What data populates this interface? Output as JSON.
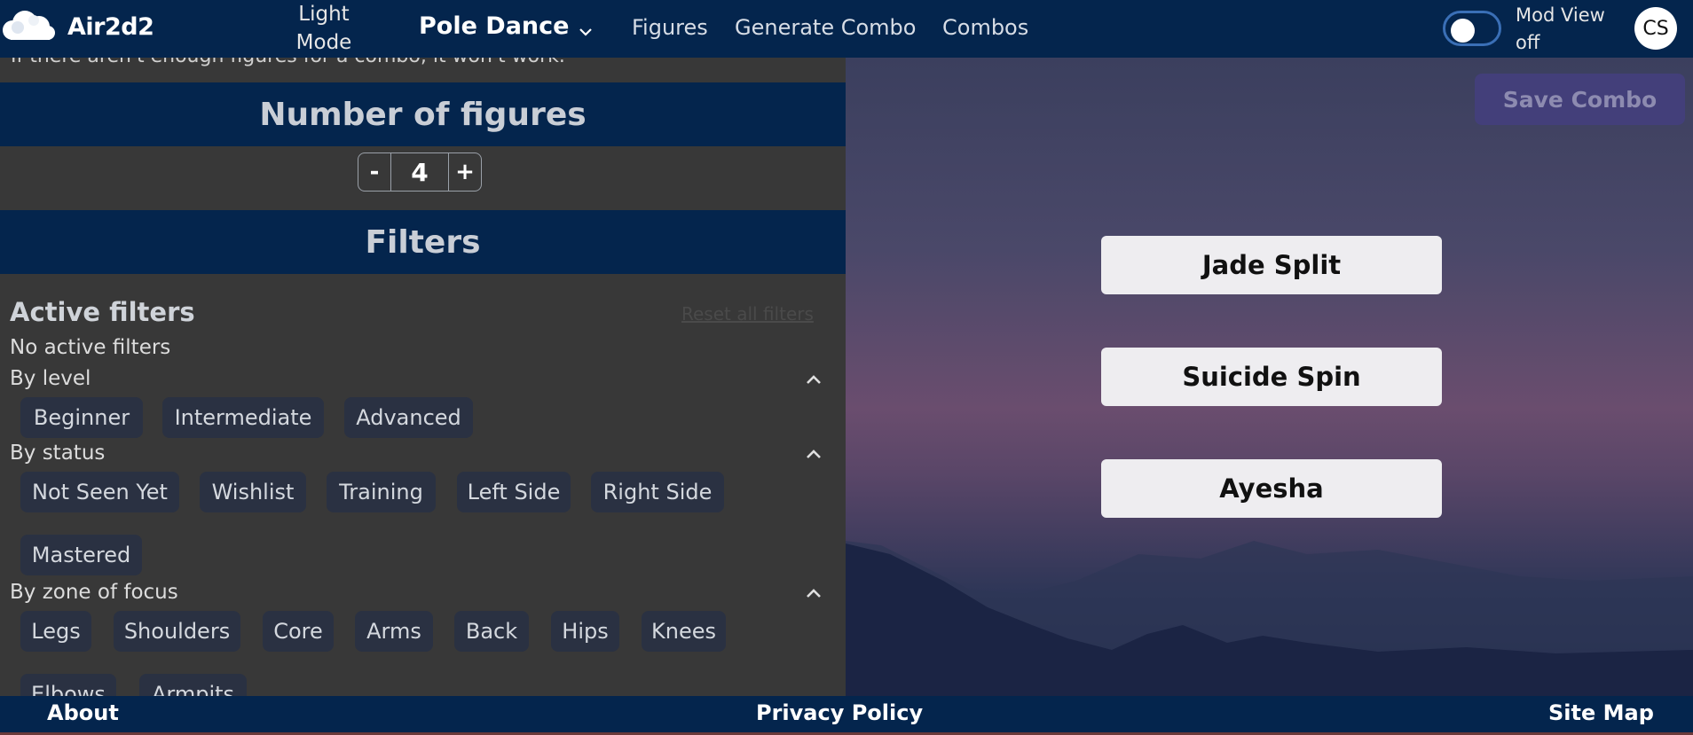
{
  "nav": {
    "brand": "Air2d2",
    "light_mode_line1": "Light",
    "light_mode_line2": "Mode",
    "sport": "Pole Dance",
    "links": [
      "Figures",
      "Generate Combo",
      "Combos"
    ],
    "mod_view_line1": "Mod View",
    "mod_view_line2": "off",
    "avatar_initials": "CS"
  },
  "left": {
    "cut_note": "If there aren't enough figures for a combo, it won't work.",
    "number_heading": "Number of figures",
    "stepper": {
      "minus": "-",
      "value": "4",
      "plus": "+"
    },
    "filters_heading": "Filters",
    "active_filters_title": "Active filters",
    "reset_label": "Reset all filters",
    "no_active": "No active filters",
    "groups": {
      "level": {
        "label": "By level",
        "chips": [
          "Beginner",
          "Intermediate",
          "Advanced"
        ]
      },
      "status": {
        "label": "By status",
        "chips": [
          "Not Seen Yet",
          "Wishlist",
          "Training",
          "Left Side",
          "Right Side",
          "Mastered"
        ]
      },
      "zone": {
        "label": "By zone of focus",
        "chips": [
          "Legs",
          "Shoulders",
          "Core",
          "Arms",
          "Back",
          "Hips",
          "Knees",
          "Elbows",
          "Armpits"
        ]
      }
    }
  },
  "right": {
    "save_label": "Save Combo",
    "figures": [
      "Jade Split",
      "Suicide Spin",
      "Ayesha"
    ]
  },
  "footer": {
    "about": "About",
    "privacy": "Privacy Policy",
    "sitemap": "Site Map"
  },
  "colors": {
    "nav_bg": "#04254d",
    "panel_bg": "#383838",
    "chip_bg": "#2a3142",
    "save_bg": "#433f7a"
  }
}
